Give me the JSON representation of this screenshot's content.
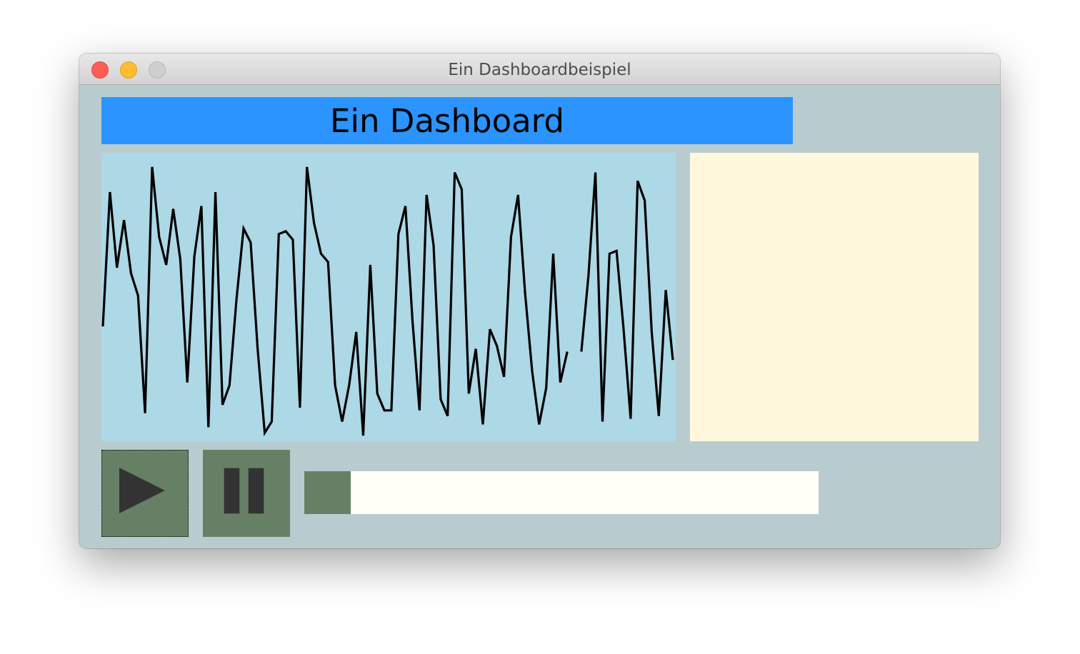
{
  "window": {
    "title": "Ein Dashboardbeispiel"
  },
  "header": {
    "title": "Ein Dashboard",
    "background": "#2b94ff"
  },
  "colors": {
    "content_bg": "#b8cccf",
    "chart_bg": "#add8e6",
    "side_panel_bg": "#fff8dc",
    "button_bg": "#668066",
    "icon_color": "#333333",
    "progress_track": "#fefff6",
    "progress_fill": "#668066"
  },
  "controls": {
    "play_icon": "play-icon",
    "pause_icon": "pause-icon"
  },
  "progress": {
    "fraction": 0.09
  },
  "chart_data": {
    "type": "line",
    "title": "",
    "xlabel": "",
    "ylabel": "",
    "grid": false,
    "ylim": [
      0,
      1
    ],
    "series": [
      {
        "values": [
          0.4,
          0.88,
          0.61,
          0.78,
          0.59,
          0.51,
          0.09,
          0.97,
          0.72,
          0.62,
          0.82,
          0.64,
          0.2,
          0.65,
          0.83,
          0.04,
          0.88,
          0.12,
          0.19,
          0.5,
          0.75,
          0.7,
          0.32,
          0.02,
          0.06,
          0.73,
          0.74,
          0.71,
          0.11,
          0.97,
          0.77,
          0.66,
          0.63,
          0.19,
          0.06,
          0.19,
          0.38,
          0.01,
          0.62,
          0.16,
          0.1,
          0.1,
          0.73,
          0.83,
          0.42,
          0.1,
          0.87,
          0.69,
          0.14,
          0.08,
          0.95,
          0.89,
          0.16,
          0.32,
          0.05,
          0.39,
          0.33,
          0.22,
          0.72,
          0.87,
          0.52,
          0.24,
          0.05,
          0.18,
          0.66,
          0.2,
          0.31,
          null,
          0.31,
          0.58,
          0.95,
          0.06,
          0.66,
          0.67,
          0.39,
          0.07,
          0.92,
          0.85,
          0.38,
          0.08,
          0.53,
          0.28
        ]
      }
    ]
  }
}
